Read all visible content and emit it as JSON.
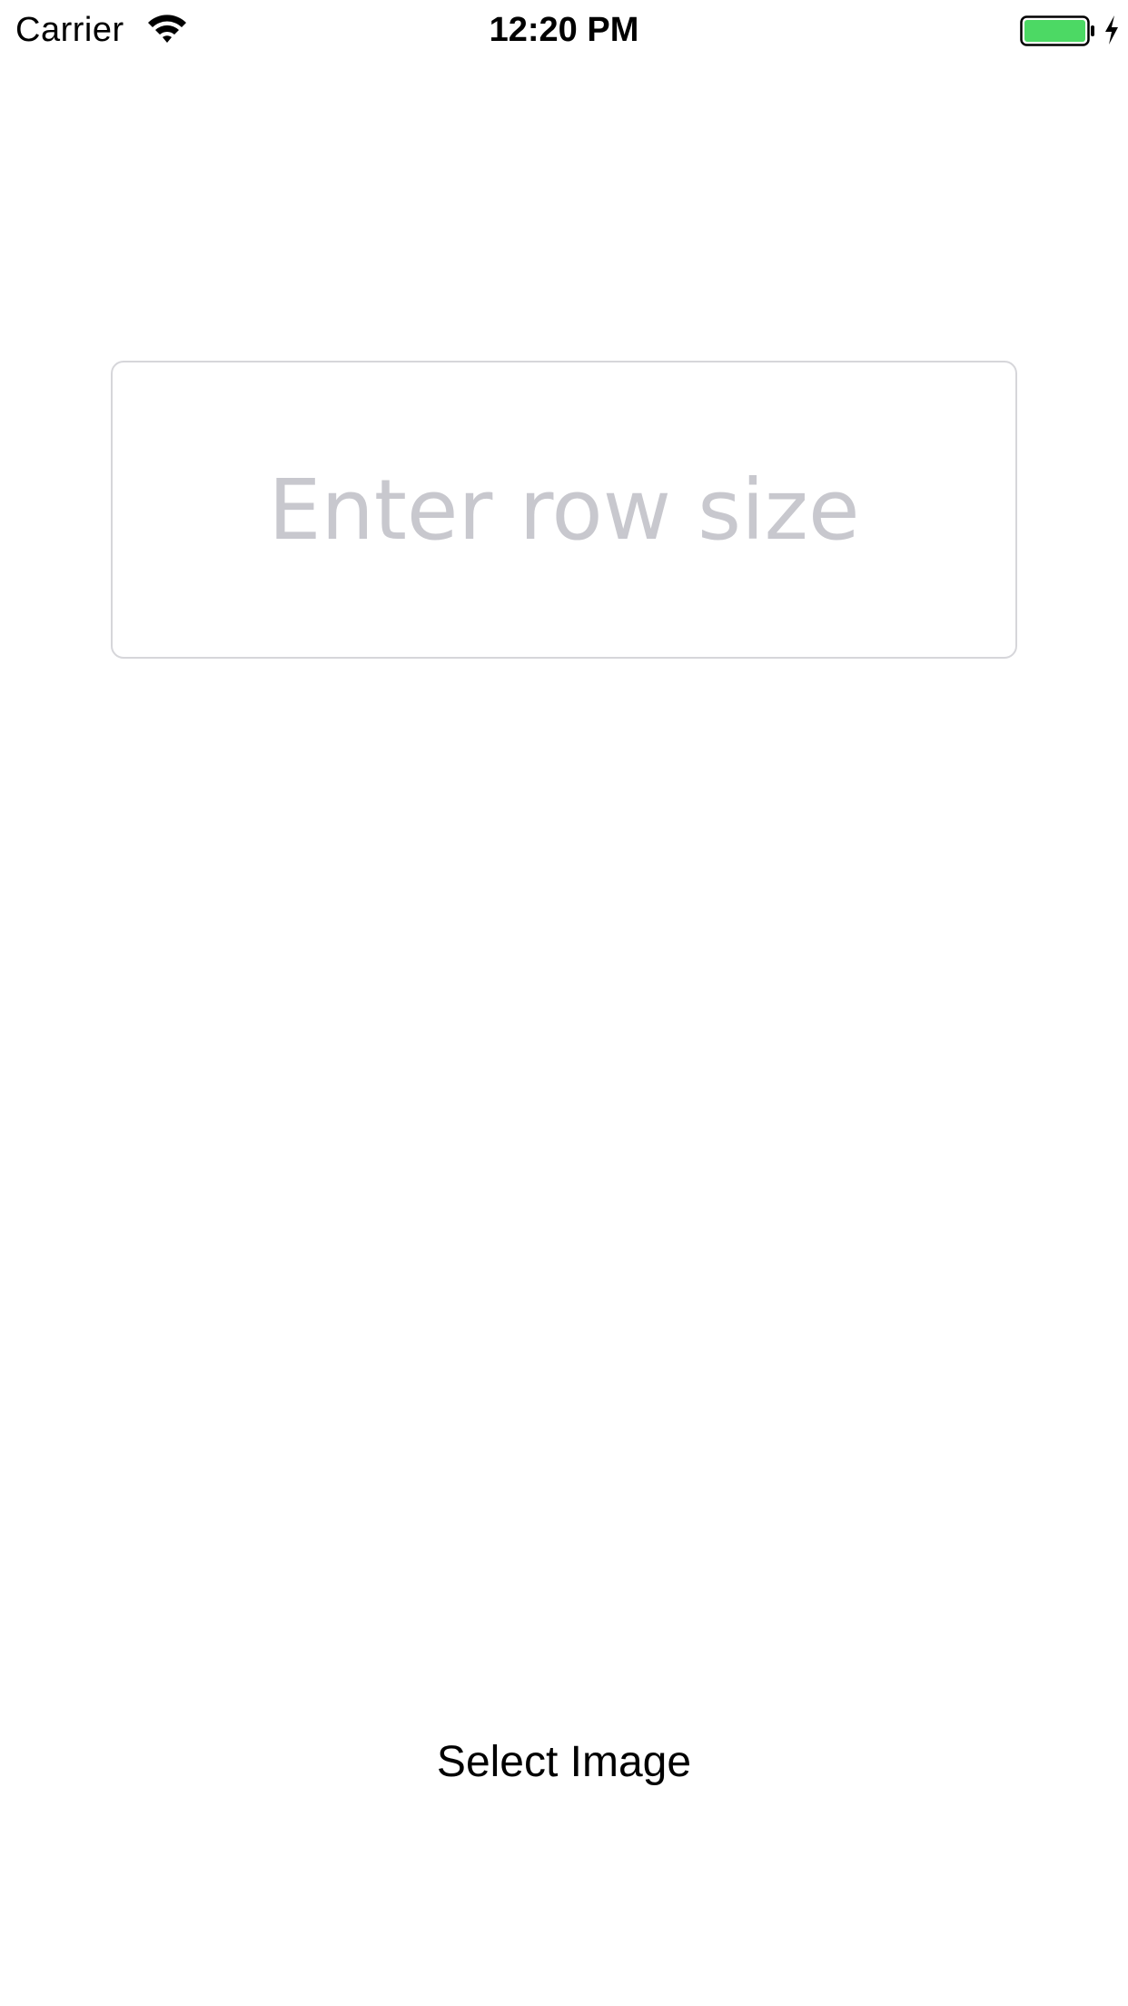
{
  "status_bar": {
    "carrier": "Carrier",
    "time": "12:20 PM",
    "wifi_icon": "wifi-icon",
    "battery_icon": "battery-full-icon",
    "charging_icon": "charging-bolt-icon",
    "battery_level": 1.0,
    "battery_color": "#4cd964"
  },
  "main": {
    "row_size_input": {
      "value": "",
      "placeholder": "Enter row size"
    },
    "select_image_button": {
      "label": "Select Image"
    }
  }
}
